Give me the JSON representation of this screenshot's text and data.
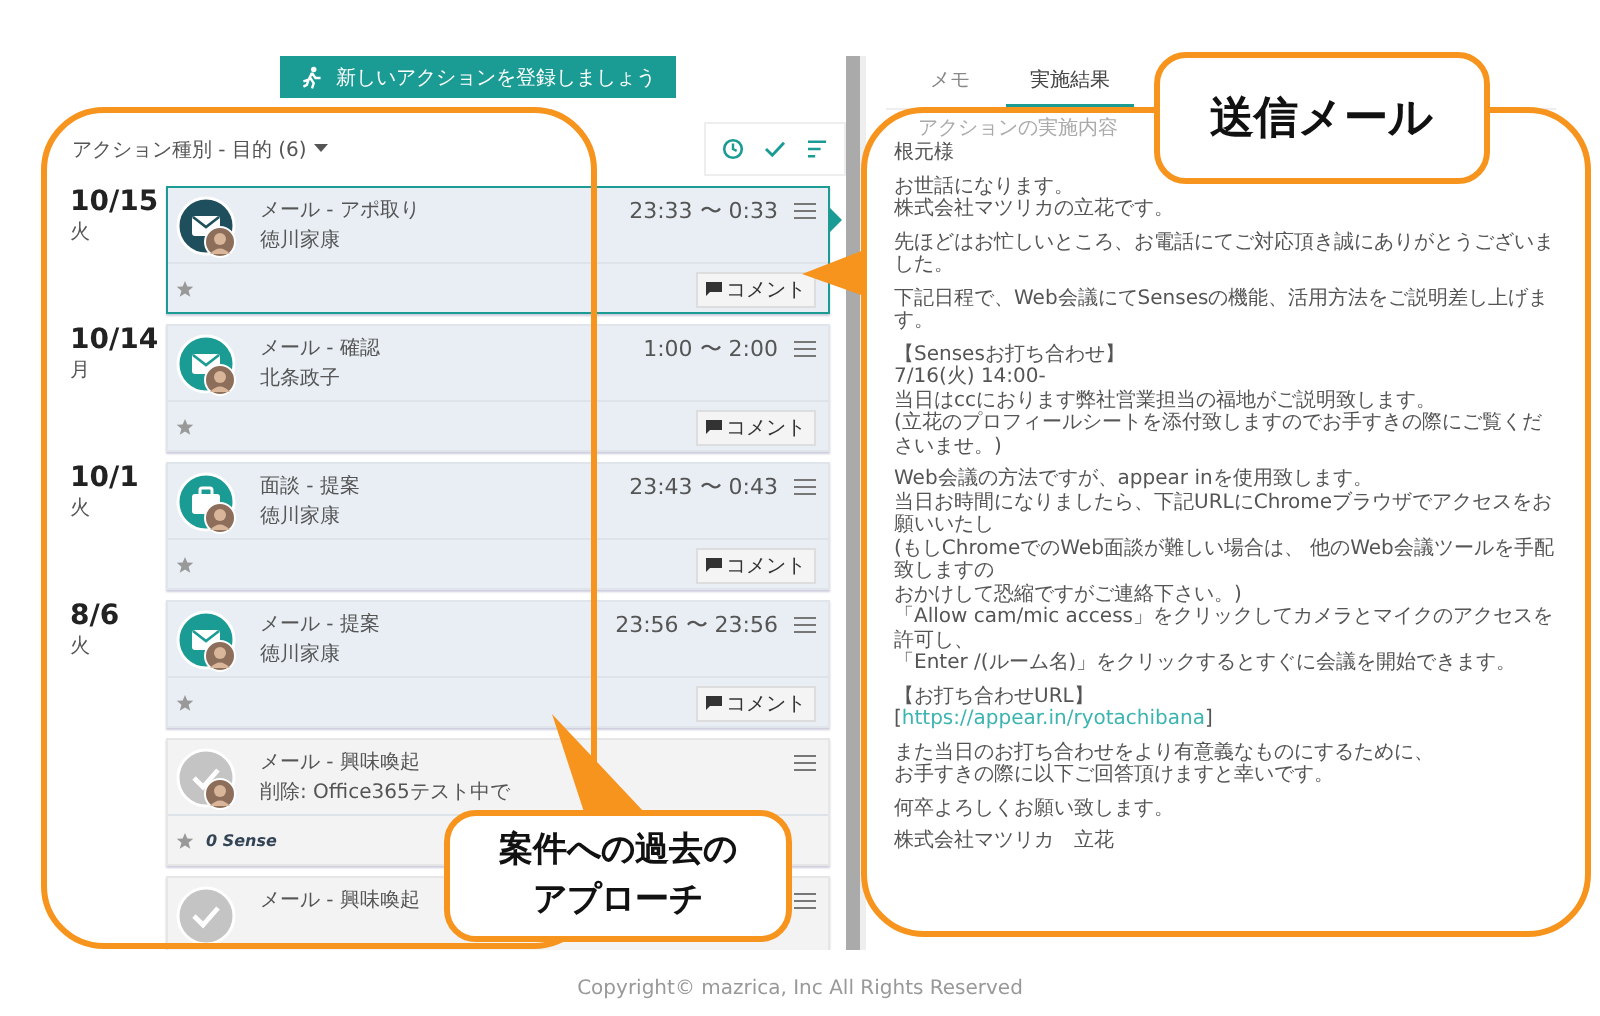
{
  "new_action_button": "新しいアクションを登録しましょう",
  "filter": {
    "label": "アクション種別 - 目的 (6)"
  },
  "actions": [
    {
      "kind": "mail",
      "date": "10/15",
      "weekday": "火",
      "title": "メール - アポ取り",
      "person": "徳川家康",
      "time": "23:33 〜 0:33",
      "comment": "コメント",
      "selected": true
    },
    {
      "kind": "mail",
      "date": "10/14",
      "weekday": "月",
      "title": "メール - 確認",
      "person": "北条政子",
      "time": "1:00 〜 2:00",
      "comment": "コメント",
      "selected": false
    },
    {
      "kind": "meeting",
      "date": "10/1",
      "weekday": "火",
      "title": "面談 - 提案",
      "person": "徳川家康",
      "time": "23:43 〜 0:43",
      "comment": "コメント",
      "selected": false
    },
    {
      "kind": "mail",
      "date": "8/6",
      "weekday": "火",
      "title": "メール - 提案",
      "person": "徳川家康",
      "time": "23:56 〜 23:56",
      "comment": "コメント",
      "selected": false
    },
    {
      "kind": "done",
      "title": "メール - 興味喚起",
      "person": "削除: Office365テスト中で",
      "sense": "0 Sense",
      "selected": false
    },
    {
      "kind": "done",
      "title": "メール - 興味喚起",
      "selected": false
    }
  ],
  "detail": {
    "tabs": [
      {
        "label": "メモ",
        "selected": false
      },
      {
        "label": "実施結果",
        "selected": true
      }
    ],
    "field_label": "アクションの実施内容",
    "paragraphs": [
      {
        "lines": [
          "根元様"
        ]
      },
      {
        "lines": [
          "お世話になります。",
          "株式会社マツリカの立花です。"
        ]
      },
      {
        "lines": [
          "先ほどはお忙しいところ、お電話にてご対応頂き誠にありがとうございました。"
        ]
      },
      {
        "lines": [
          "下記日程で、Web会議にてSensesの機能、活用方法をご説明差し上げます。"
        ]
      },
      {
        "lines": [
          "【Sensesお打ち合わせ】",
          "7/16(火) 14:00-",
          "当日はccにおります弊社営業担当の福地がご説明致します。",
          "(立花のプロフィールシートを添付致しますのでお手すきの際にご覧くださいませ。)"
        ]
      },
      {
        "lines": [
          "Web会議の方法ですが、appear inを使用致します。",
          "当日お時間になりましたら、下記URLにChromeブラウザでアクセスをお願いいたし",
          "(もしChromeでのWeb面談が難しい場合は、 他のWeb会議ツールを手配致しますの",
          "おかけして恐縮ですがご連絡下さい。)",
          "「Allow cam/mic access」をクリックしてカメラとマイクのアクセスを許可し、",
          "「Enter /(ルーム名)」をクリックするとすぐに会議を開始できます。"
        ]
      },
      {
        "lines": [
          "【お打ち合わせURL】"
        ],
        "link": {
          "before": "[",
          "url": "https://appear.in/ryotachibana",
          "after": "]"
        }
      },
      {
        "lines": [
          "また当日のお打ち合わせをより有意義なものにするために、",
          "お手すきの際に以下ご回答頂けますと幸いです。"
        ]
      },
      {
        "lines": [
          "何卒よろしくお願い致します。"
        ]
      },
      {
        "lines": [
          "株式会社マツリカ　立花"
        ]
      }
    ]
  },
  "callouts": [
    {
      "lines": [
        "送信メール"
      ]
    },
    {
      "lines": [
        "案件への過去の",
        "アプローチ"
      ]
    }
  ],
  "copyright": "Copyright© mazrica, Inc All Rights Reserved"
}
